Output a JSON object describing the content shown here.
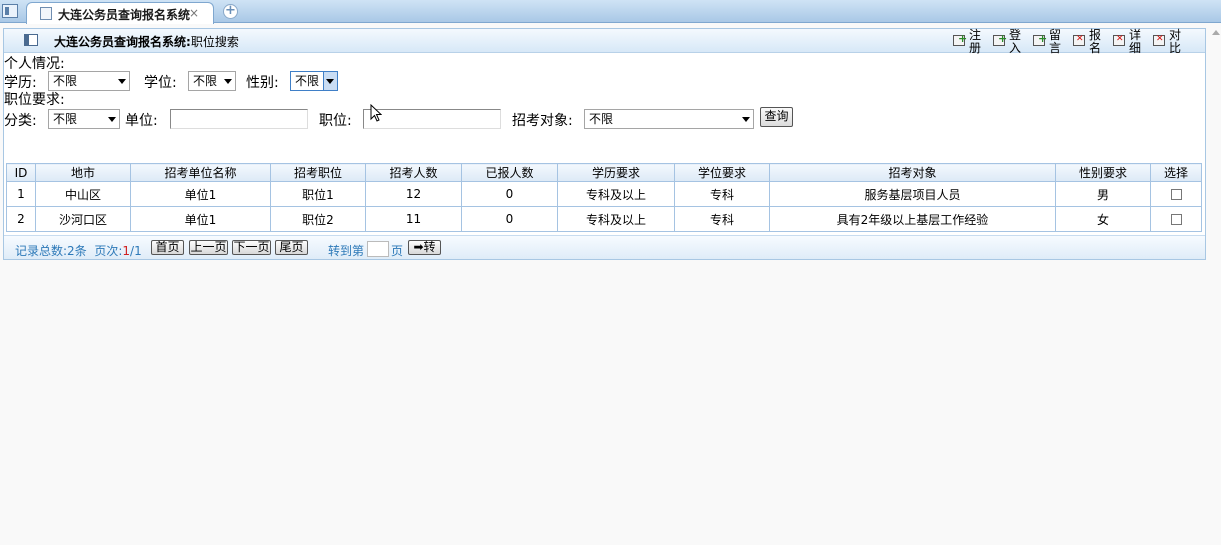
{
  "tab": {
    "title": "大连公务员查询报名系统",
    "close": "×",
    "new_tab": "+"
  },
  "panel": {
    "title": "大连公务员查询报名系统:",
    "subtitle": "职位搜索"
  },
  "toolbar": [
    {
      "label": "注册",
      "icon": "add-icon"
    },
    {
      "label": "登入",
      "icon": "add-icon"
    },
    {
      "label": "留言",
      "icon": "add-icon"
    },
    {
      "label": "报名",
      "icon": "delete-icon"
    },
    {
      "label": "详细",
      "icon": "delete-icon"
    },
    {
      "label": "对比",
      "icon": "delete-icon"
    }
  ],
  "personal": {
    "heading": "个人情况:",
    "education_label": "学历:",
    "education_value": "不限",
    "degree_label": "学位:",
    "degree_value": "不限",
    "gender_label": "性别:",
    "gender_value": "不限"
  },
  "requirements": {
    "heading": "职位要求:",
    "category_label": "分类:",
    "category_value": "不限",
    "unit_label": "单位:",
    "position_label": "职位:",
    "target_label": "招考对象:",
    "target_value": "不限",
    "query_button": "查询"
  },
  "table": {
    "headers": [
      "ID",
      "地市",
      "招考单位名称",
      "招考职位",
      "招考人数",
      "已报人数",
      "学历要求",
      "学位要求",
      "招考对象",
      "性别要求",
      "选择"
    ],
    "rows": [
      [
        "1",
        "中山区",
        "单位1",
        "职位1",
        "12",
        "0",
        "专科及以上",
        "专科",
        "服务基层项目人员",
        "男"
      ],
      [
        "2",
        "沙河口区",
        "单位1",
        "职位2",
        "11",
        "0",
        "专科及以上",
        "专科",
        "具有2年级以上基层工作经验",
        "女"
      ]
    ]
  },
  "pager": {
    "total_label": "记录总数:",
    "total": "2",
    "total_unit": "条",
    "pages_label": "页次:",
    "current_page": "1",
    "page_sep": "/",
    "total_pages": "1",
    "first": "首页",
    "prev": "上一页",
    "next": "下一页",
    "last": "尾页",
    "goto_label": "转到第",
    "goto_unit": "页",
    "go": "➡转"
  }
}
